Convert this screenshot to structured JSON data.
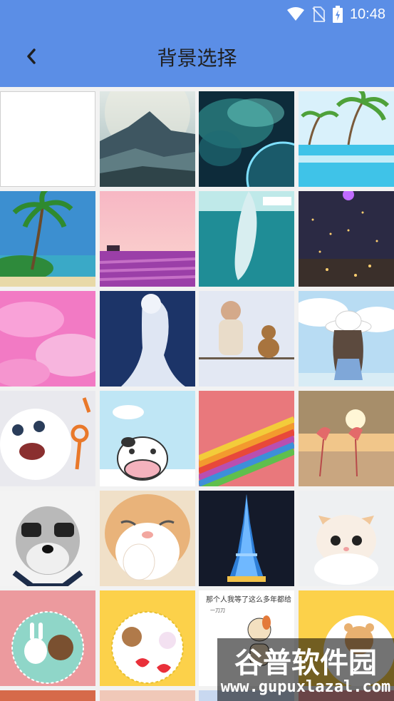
{
  "status": {
    "time": "10:48",
    "icons": [
      "wifi-icon",
      "no-sim-icon",
      "battery-charging-icon"
    ]
  },
  "header": {
    "title": "背景选择",
    "back_icon": "chevron-left-icon"
  },
  "tiles": [
    "blank-white",
    "mountains",
    "nebula-planet",
    "beach-pool",
    "palm-beach",
    "lavander-field",
    "whale-sky",
    "night-lights",
    "pink-clouds",
    "night-girl",
    "baby-teddy",
    "girl-hat",
    "white-rabbit",
    "cartoon-cow",
    "rainbow-stripes",
    "flamingo-sunset",
    "dog-glasses",
    "cat-closeup",
    "eiffel-night",
    "kitten",
    "bunny-bear-pink",
    "bear-bunny-yellow",
    "cartoon-dog-text",
    "bear-yellow"
  ],
  "tile_texts": {
    "cartoon_dog_caption": "那个人我等了这么多年都给",
    "cartoon_dog_sub": "一刀刀"
  },
  "watermark": {
    "main": "谷普软件园",
    "sub": "www.gupuxlazal.com"
  },
  "colors": {
    "appbar": "#5b8ee6",
    "title": "#1f1f1f"
  }
}
